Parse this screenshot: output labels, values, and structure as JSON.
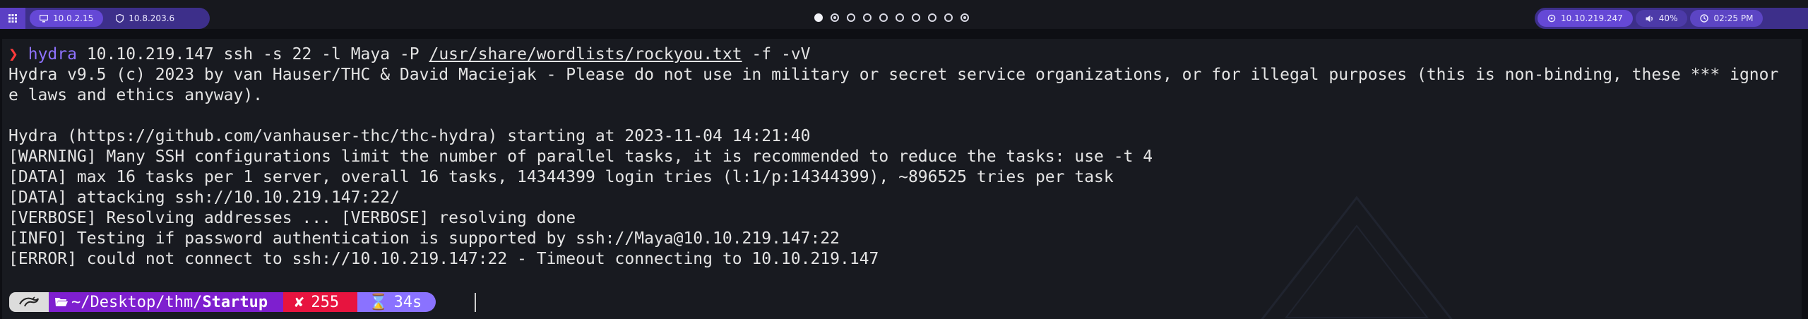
{
  "topbar": {
    "menu_icon": "grid-icon",
    "left_ip1": "10.0.2.15",
    "left_ip2": "10.8.203.6",
    "workspaces": [
      {
        "state": "active"
      },
      {
        "state": "occupied"
      },
      {
        "state": "empty"
      },
      {
        "state": "empty"
      },
      {
        "state": "empty"
      },
      {
        "state": "empty"
      },
      {
        "state": "empty"
      },
      {
        "state": "empty"
      },
      {
        "state": "empty"
      },
      {
        "state": "occupied"
      }
    ],
    "target_ip": "10.10.219.247",
    "volume": "40%",
    "clock": "02:25 PM"
  },
  "terminal": {
    "prompt_symbol": "❯",
    "command_name": "hydra",
    "command_args_1": " 10.10.219.147 ssh -s 22 -l Maya -P ",
    "command_path": "/usr/share/wordlists/rockyou.txt",
    "command_args_2": " -f -vV",
    "lines": [
      "Hydra v9.5 (c) 2023 by van Hauser/THC & David Maciejak - Please do not use in military or secret service organizations, or for illegal purposes (this is non-binding, these *** ignor",
      "e laws and ethics anyway).",
      "",
      "Hydra (https://github.com/vanhauser-thc/thc-hydra) starting at 2023-11-04 14:21:40",
      "[WARNING] Many SSH configurations limit the number of parallel tasks, it is recommended to reduce the tasks: use -t 4",
      "[DATA] max 16 tasks per 1 server, overall 16 tasks, 14344399 login tries (l:1/p:14344399), ~896525 tries per task",
      "[DATA] attacking ssh://10.10.219.147:22/",
      "[VERBOSE] Resolving addresses ... [VERBOSE] resolving done",
      "[INFO] Testing if password authentication is supported by ssh://Maya@10.10.219.147:22",
      "[ERROR] could not connect to ssh://10.10.219.147:22 - Timeout connecting to 10.10.219.147"
    ]
  },
  "promptbar": {
    "os_icon": "kali-dragon-icon",
    "dir_prefix": "~/Desktop/thm/",
    "dir_current": "Startup",
    "exit_symbol": "✘",
    "exit_code": "255",
    "duration_symbol": "⌛",
    "duration": "34s"
  }
}
